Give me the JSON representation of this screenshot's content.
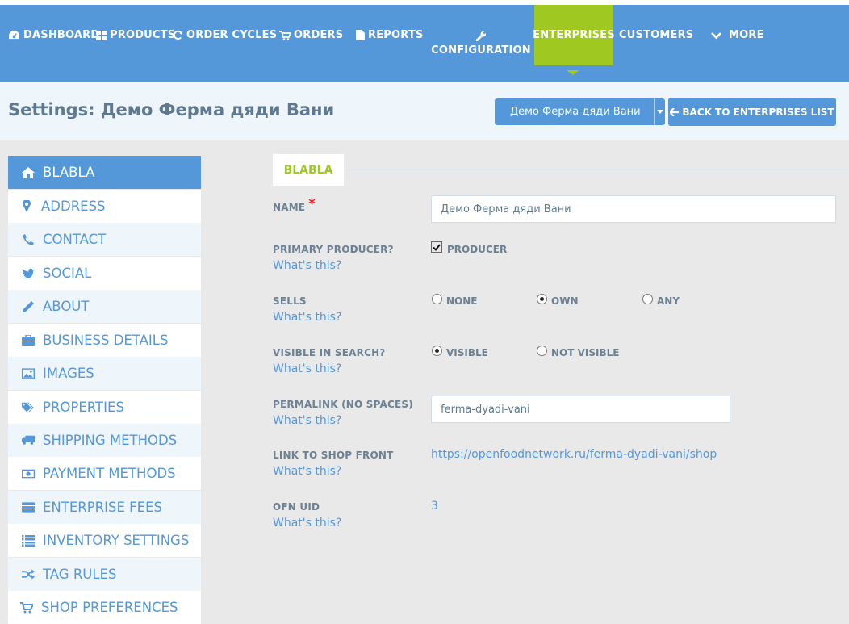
{
  "nav": {
    "items": [
      {
        "label": "DASHBOARD",
        "icon": "dashboard-icon"
      },
      {
        "label": "PRODUCTS",
        "icon": "products-grid-icon"
      },
      {
        "label": "ORDER CYCLES",
        "icon": "refresh-icon"
      },
      {
        "label": "ORDERS",
        "icon": "cart-icon"
      },
      {
        "label": "REPORTS",
        "icon": "file-icon"
      },
      {
        "label": "CONFIGURATION",
        "icon": "wrench-icon"
      },
      {
        "label": "ENTERPRISES",
        "active": true
      },
      {
        "label": "CUSTOMERS"
      },
      {
        "label": "MORE",
        "icon": "chevron-down-icon"
      }
    ],
    "active_color": "#9fc820",
    "bar_color": "#5498da"
  },
  "header": {
    "title": "Settings: Демо Ферма дяди Вани",
    "enterprise_select": "Демо Ферма дяди Вани",
    "back_button": "BACK TO ENTERPRISES LIST"
  },
  "sidebar": {
    "items": [
      {
        "label": "BLABLA",
        "icon": "home-icon",
        "active": true
      },
      {
        "label": "ADDRESS",
        "icon": "map-marker-icon"
      },
      {
        "label": "CONTACT",
        "icon": "phone-icon"
      },
      {
        "label": "SOCIAL",
        "icon": "twitter-icon"
      },
      {
        "label": "ABOUT",
        "icon": "pencil-icon"
      },
      {
        "label": "BUSINESS DETAILS",
        "icon": "briefcase-icon"
      },
      {
        "label": "IMAGES",
        "icon": "picture-icon"
      },
      {
        "label": "PROPERTIES",
        "icon": "tags-icon"
      },
      {
        "label": "SHIPPING METHODS",
        "icon": "truck-icon"
      },
      {
        "label": "PAYMENT METHODS",
        "icon": "money-icon"
      },
      {
        "label": "ENTERPRISE FEES",
        "icon": "credit-card-icon"
      },
      {
        "label": "INVENTORY SETTINGS",
        "icon": "list-icon"
      },
      {
        "label": "TAG RULES",
        "icon": "shuffle-icon"
      },
      {
        "label": "SHOP PREFERENCES",
        "icon": "cart-icon"
      }
    ]
  },
  "form": {
    "tab": "BLABLA",
    "whats_this": "What's this?",
    "name_label": "NAME",
    "required_mark": "*",
    "name_value": "Демо Ферма дяди Вани",
    "primary_producer_label": "PRIMARY PRODUCER?",
    "producer_option": "PRODUCER",
    "producer_checked": true,
    "sells_label": "SELLS",
    "sells_options": [
      "NONE",
      "OWN",
      "ANY"
    ],
    "sells_selected": "OWN",
    "visible_label": "VISIBLE IN SEARCH?",
    "visible_options": [
      "VISIBLE",
      "NOT VISIBLE"
    ],
    "visible_selected": "VISIBLE",
    "permalink_label": "PERMALINK (NO SPACES)",
    "permalink_value": "ferma-dyadi-vani",
    "shopfront_label": "LINK TO SHOP FRONT",
    "shopfront_url": "https://openfoodnetwork.ru/ferma-dyadi-vani/shop",
    "uid_label": "OFN UID",
    "uid_value": "3"
  }
}
